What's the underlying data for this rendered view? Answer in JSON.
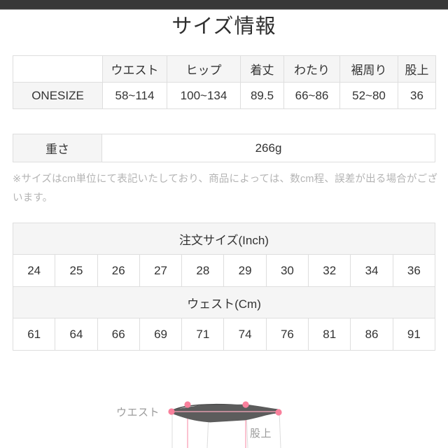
{
  "page": {
    "title": "サイズ情報"
  },
  "size_table": {
    "name": "size-measurements-table",
    "headers": [
      "",
      "ウエスト",
      "ヒップ",
      "着丈",
      "わたり",
      "裾周り",
      "股上"
    ],
    "rows": [
      {
        "label": "ONESIZE",
        "values": [
          "58~114",
          "100~134",
          "89.5",
          "66~86",
          "52~80",
          "36"
        ]
      }
    ]
  },
  "weight_table": {
    "label": "重さ",
    "value": "266g"
  },
  "note": "※サイズはcm単位にて表記いたしており、商品によっては、数cm程、誤差が出る場合がございます。",
  "order_table": {
    "inch_header": "注文サイズ(Inch)",
    "inch_values": [
      "24",
      "25",
      "26",
      "27",
      "28",
      "29",
      "30",
      "32",
      "34",
      "36"
    ],
    "cm_header": "ウェスト(Cm)",
    "cm_values": [
      "61",
      "64",
      "66",
      "69",
      "71",
      "74",
      "76",
      "81",
      "86",
      "91"
    ]
  },
  "diagram": {
    "waist_label": "ウエスト",
    "rise_label": "股上",
    "marker_color": "#f98aa4",
    "garment_color": "#5c5c5c",
    "guide_color": "#d8d8d8"
  },
  "colors": {
    "top_bar": "#383838",
    "table_border": "#dedede",
    "shade": "#f5f5f5",
    "text": "#333333",
    "note_text": "#b4b4b4"
  }
}
